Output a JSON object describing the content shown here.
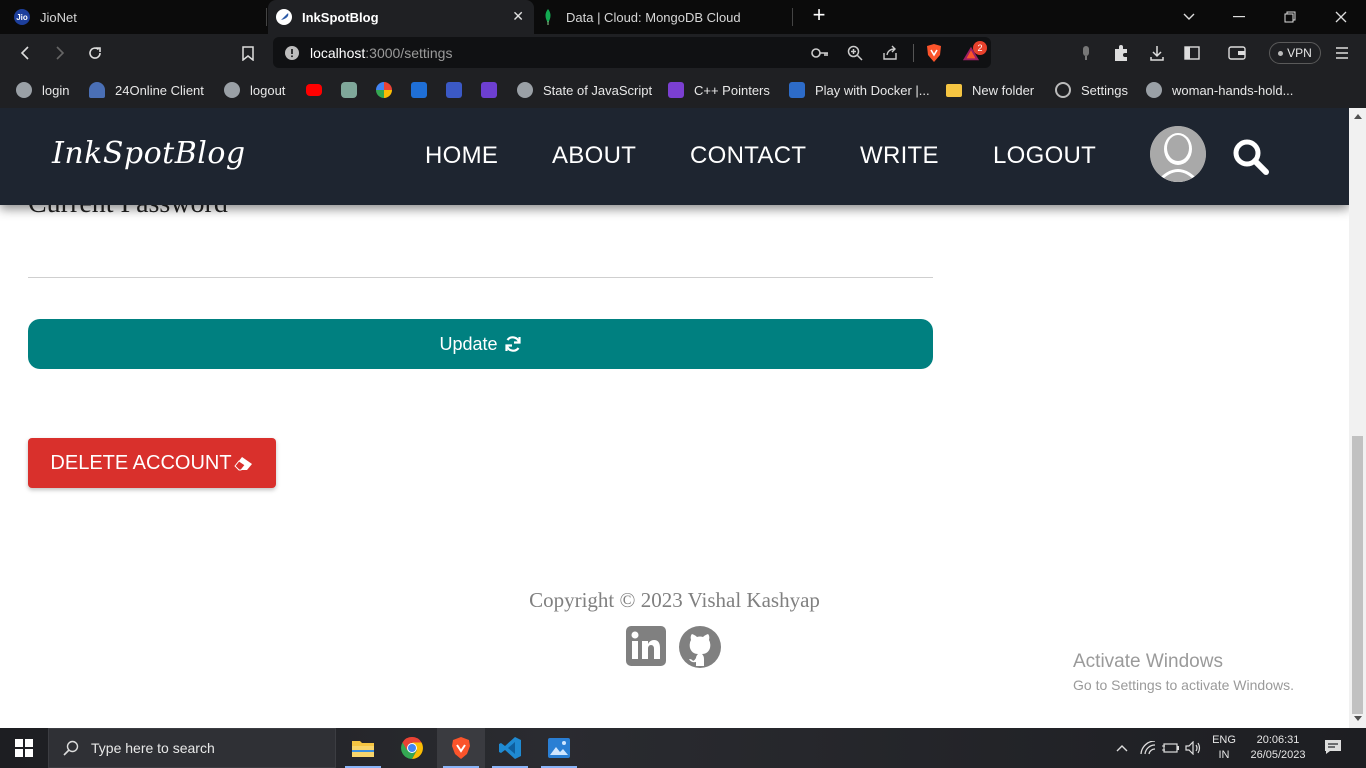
{
  "browser": {
    "tabs": [
      {
        "label": "JioNet",
        "favicon": "jio-logo-icon",
        "active": false
      },
      {
        "label": "InkSpotBlog",
        "favicon": "feather-icon",
        "active": true
      },
      {
        "label": "Data | Cloud: MongoDB Cloud",
        "favicon": "mongodb-leaf-icon",
        "active": false
      }
    ],
    "jio_badge": "Jio",
    "url_host": "localhost",
    "url_path": ":3000/settings",
    "brave_rewards_count": "2",
    "vpn_label": "VPN",
    "bookmarks": [
      {
        "label": "login",
        "icon": "globe-icon"
      },
      {
        "label": "24Online Client",
        "icon": "cloud-icon"
      },
      {
        "label": "logout",
        "icon": "globe-icon"
      },
      {
        "label": "",
        "icon": "youtube-icon"
      },
      {
        "label": "",
        "icon": "openai-icon"
      },
      {
        "label": "",
        "icon": "google-icon"
      },
      {
        "label": "",
        "icon": "s-logo-icon"
      },
      {
        "label": "",
        "icon": "code-icon"
      },
      {
        "label": "",
        "icon": "lightning-icon"
      },
      {
        "label": "State of JavaScript",
        "icon": "globe-icon"
      },
      {
        "label": "C++ Pointers",
        "icon": "cpp-icon"
      },
      {
        "label": "Play with Docker |...",
        "icon": "docker-icon"
      },
      {
        "label": "New folder",
        "icon": "folder-icon"
      },
      {
        "label": "Settings",
        "icon": "gear-icon"
      },
      {
        "label": "woman-hands-hold...",
        "icon": "globe-icon"
      }
    ]
  },
  "site": {
    "logo": "InkSpotBlog",
    "nav": [
      "HOME",
      "ABOUT",
      "CONTACT",
      "WRITE",
      "LOGOUT"
    ],
    "form": {
      "current_password_label": "Current Password",
      "current_password_value": "",
      "update_label": "Update",
      "delete_label": "DELETE ACCOUNT"
    },
    "footer": {
      "copyright": "Copyright © 2023 Vishal Kashyap"
    },
    "colors": {
      "nav_bg": "#1e2530",
      "update_btn": "#008080",
      "delete_btn": "#d9302c"
    }
  },
  "watermark": {
    "title": "Activate Windows",
    "subtitle": "Go to Settings to activate Windows."
  },
  "taskbar": {
    "search_placeholder": "Type here to search",
    "lang_top": "ENG",
    "lang_bottom": "IN",
    "time": "20:06:31",
    "date": "26/05/2023"
  }
}
